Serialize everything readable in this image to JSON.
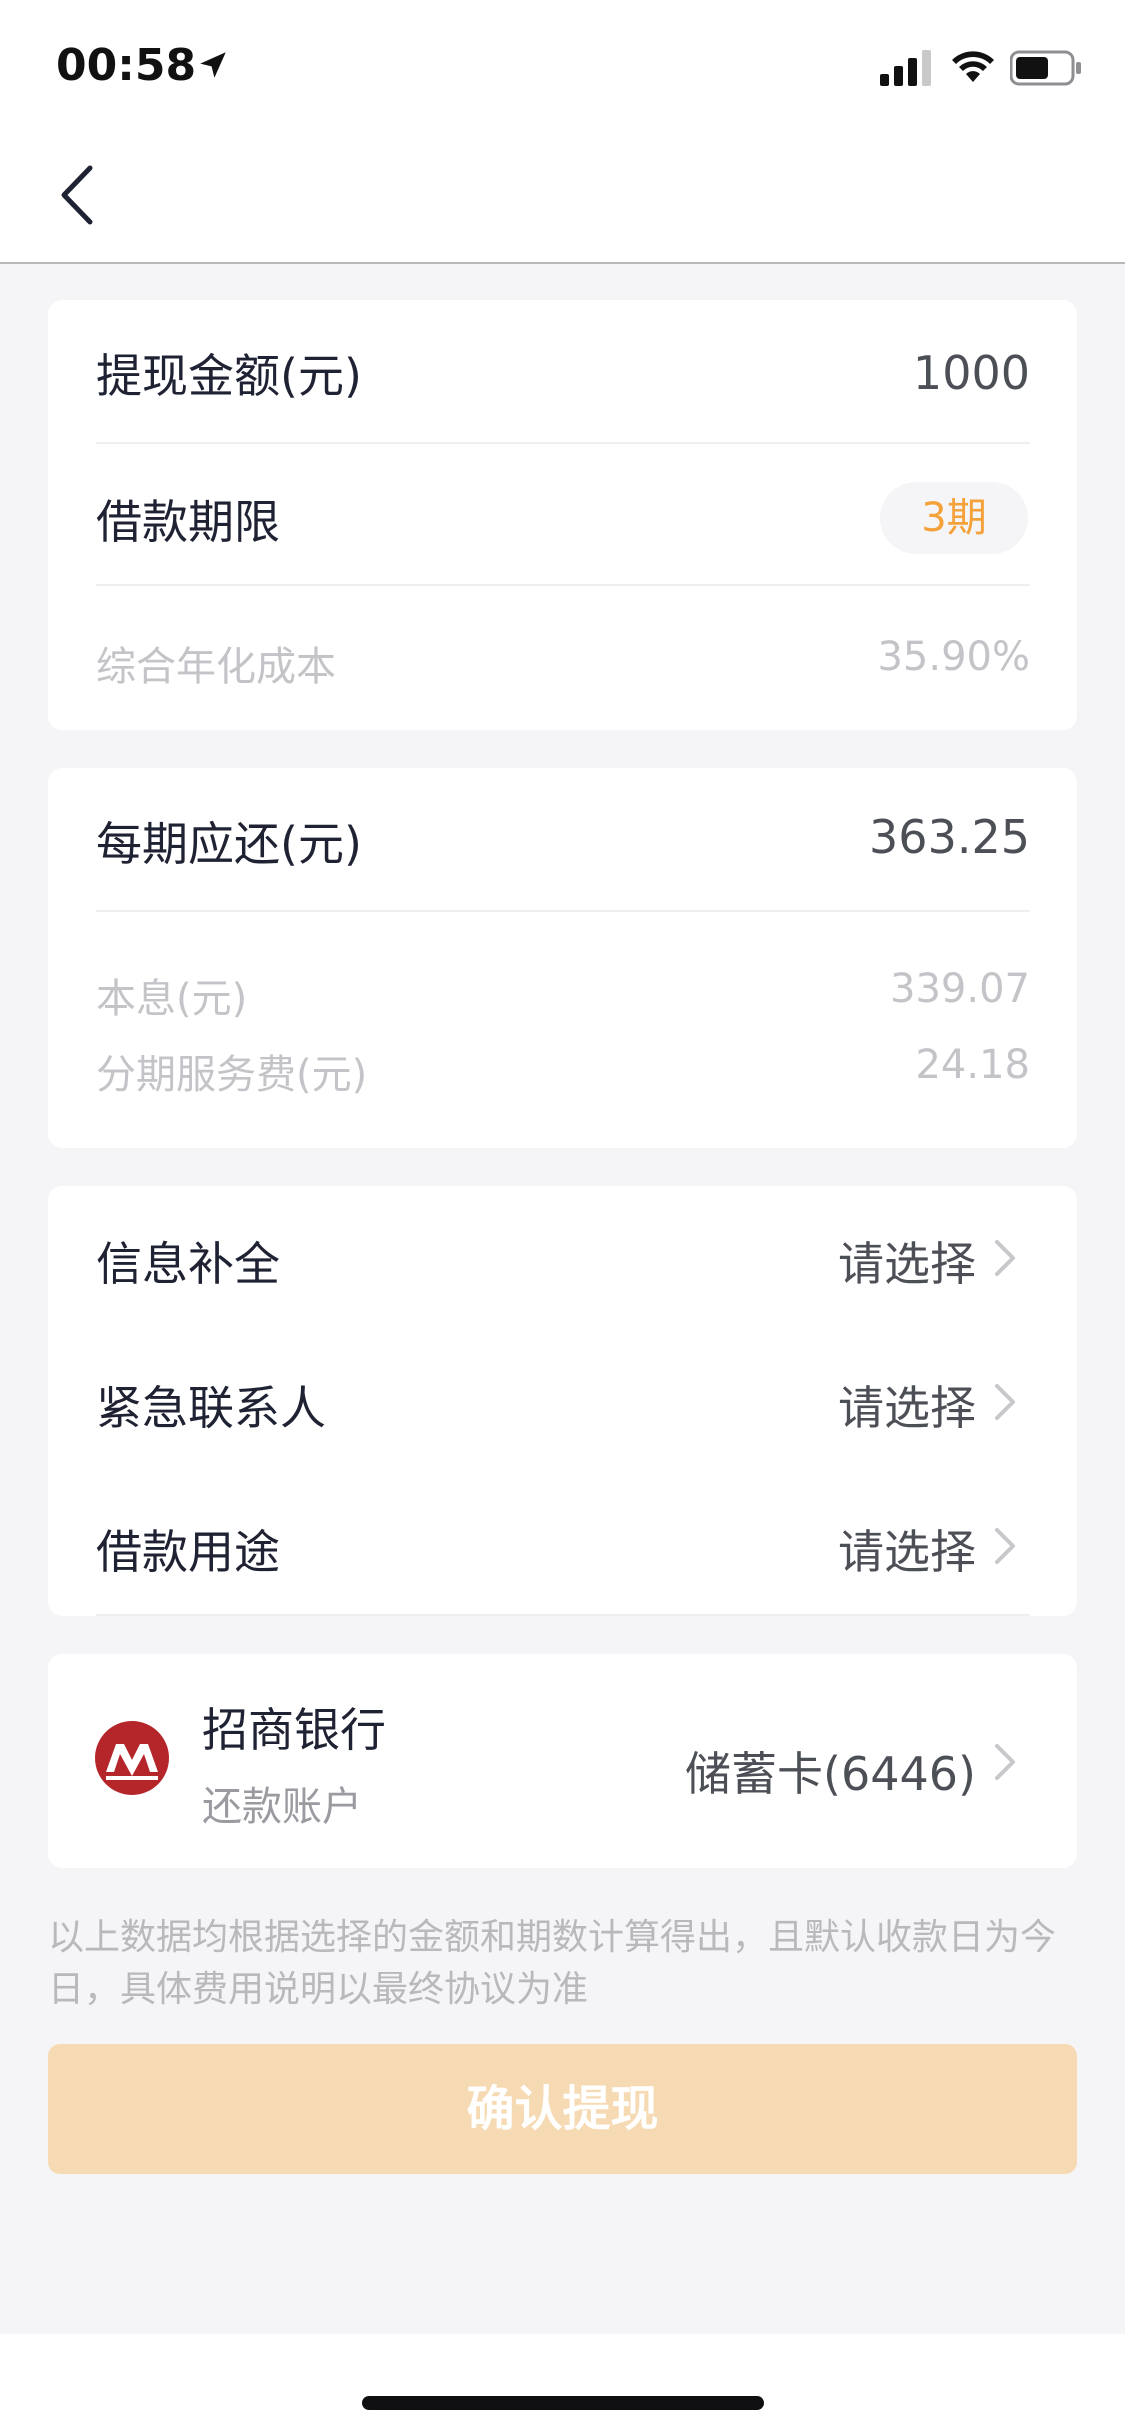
{
  "status_bar": {
    "time": "00:58"
  },
  "withdraw": {
    "amount_label": "提现金额(元)",
    "amount_value": "1000",
    "term_label": "借款期限",
    "term_value": "3期",
    "annual_cost_label": "综合年化成本",
    "annual_cost_value": "35.90%"
  },
  "repayment": {
    "per_period_label": "每期应还(元)",
    "per_period_value": "363.25",
    "principal_interest_label": "本息(元)",
    "principal_interest_value": "339.07",
    "service_fee_label": "分期服务费(元)",
    "service_fee_value": "24.18"
  },
  "options": [
    {
      "label": "信息补全",
      "value": "请选择"
    },
    {
      "label": "紧急联系人",
      "value": "请选择"
    },
    {
      "label": "借款用途",
      "value": "请选择"
    }
  ],
  "bank": {
    "name": "招商银行",
    "sub": "还款账户",
    "card": "储蓄卡(6446)"
  },
  "note": "以上数据均根据选择的金额和期数计算得出，且默认收款日为今日，具体费用说明以最终协议为准",
  "confirm_label": "确认提现",
  "colors": {
    "accent_orange": "#f4a13a",
    "button_disabled": "#f6dab3",
    "bank_red": "#b5262a"
  }
}
